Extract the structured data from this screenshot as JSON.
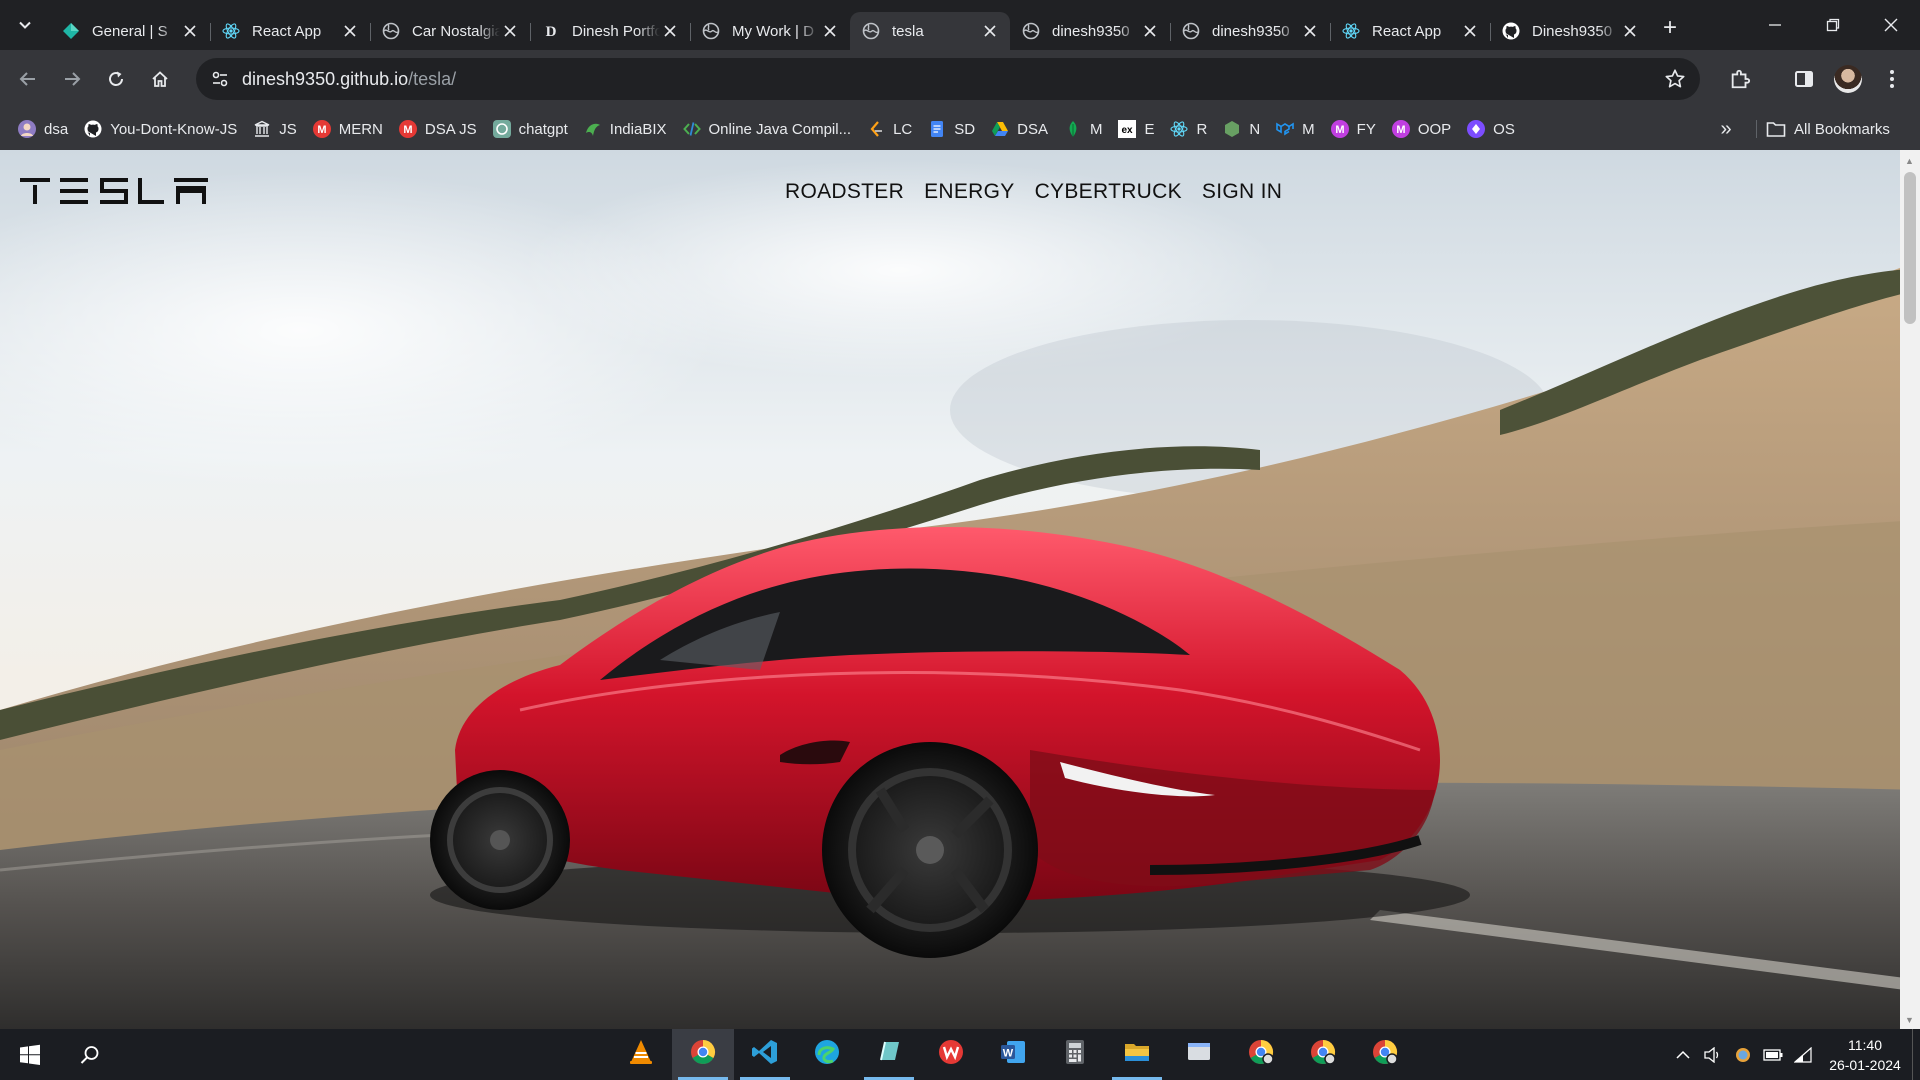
{
  "browser": {
    "tabs": [
      {
        "title": "General | S",
        "icon": "teams-diamond",
        "color": "#1fb6a6",
        "active": false
      },
      {
        "title": "React App",
        "icon": "react",
        "color": "#61dafb",
        "active": false
      },
      {
        "title": "Car Nostalgia",
        "icon": "globe",
        "color": "#bdc1c6",
        "active": false
      },
      {
        "title": "Dinesh Portfolio",
        "icon": "letter-d",
        "color": "#000000",
        "active": false
      },
      {
        "title": "My Work | D",
        "icon": "globe",
        "color": "#bdc1c6",
        "active": false
      },
      {
        "title": "tesla",
        "icon": "globe",
        "color": "#bdc1c6",
        "active": true
      },
      {
        "title": "dinesh9350",
        "icon": "globe",
        "color": "#bdc1c6",
        "active": false
      },
      {
        "title": "dinesh9350",
        "icon": "globe",
        "color": "#bdc1c6",
        "active": false
      },
      {
        "title": "React App",
        "icon": "react",
        "color": "#61dafb",
        "active": false
      },
      {
        "title": "Dinesh9350",
        "icon": "github",
        "color": "#ffffff",
        "active": false
      }
    ],
    "url_host": "dinesh9350.github.io",
    "url_path": "/tesla/",
    "bookmarks": [
      {
        "label": "dsa",
        "icon": "avatar",
        "color": "#8e7cc3"
      },
      {
        "label": "You-Dont-Know-JS",
        "icon": "github",
        "color": "#ffffff"
      },
      {
        "label": "JS",
        "icon": "building",
        "color": "#e8eaed"
      },
      {
        "label": "MERN",
        "icon": "letter-m",
        "color": "#e53935"
      },
      {
        "label": "DSA JS",
        "icon": "letter-m",
        "color": "#e53935"
      },
      {
        "label": "chatgpt",
        "icon": "chatgpt",
        "color": "#74aa9c"
      },
      {
        "label": "IndiaBIX",
        "icon": "indiabix",
        "color": "#4caf50"
      },
      {
        "label": "Online Java Compil...",
        "icon": "code",
        "color": "#4caf50"
      },
      {
        "label": "LC",
        "icon": "leetcode",
        "color": "#ffa116"
      },
      {
        "label": "SD",
        "icon": "doc",
        "color": "#4285f4"
      },
      {
        "label": "DSA",
        "icon": "drive",
        "color": "#fbbc04"
      },
      {
        "label": "M",
        "icon": "mongodb",
        "color": "#13aa52"
      },
      {
        "label": "E",
        "icon": "express",
        "color": "#ffffff"
      },
      {
        "label": "R",
        "icon": "react",
        "color": "#61dafb"
      },
      {
        "label": "N",
        "icon": "node",
        "color": "#68a063"
      },
      {
        "label": "M",
        "icon": "mui",
        "color": "#2196f3"
      },
      {
        "label": "FY",
        "icon": "letter-m",
        "color": "#c03fe0"
      },
      {
        "label": "OOP",
        "icon": "letter-m",
        "color": "#c03fe0"
      },
      {
        "label": "OS",
        "icon": "diamond",
        "color": "#7c4dff"
      }
    ],
    "all_bookmarks_label": "All Bookmarks"
  },
  "page": {
    "logo_text": "TESLA",
    "menu": [
      "ROADSTER",
      "ENERGY",
      "CYBERTRUCK",
      "SIGN IN"
    ],
    "hero_car_color": "#c8102e"
  },
  "taskbar": {
    "apps": [
      {
        "name": "vlc-icon",
        "color": "#f08a00",
        "active": false,
        "running": false
      },
      {
        "name": "chrome-icon",
        "color": "#34a853",
        "active": true,
        "running": true
      },
      {
        "name": "vscode-icon",
        "color": "#2d9fd9",
        "active": false,
        "running": true
      },
      {
        "name": "edge-icon",
        "color": "#1ea5e0",
        "active": false,
        "running": false
      },
      {
        "name": "notes-icon",
        "color": "#6fc7c9",
        "active": false,
        "running": true
      },
      {
        "name": "wps-icon",
        "color": "#e53935",
        "active": false,
        "running": false
      },
      {
        "name": "word-icon",
        "color": "#2b579a",
        "active": false,
        "running": false
      },
      {
        "name": "calculator-icon",
        "color": "#9aa0a6",
        "active": false,
        "running": false
      },
      {
        "name": "file-explorer-icon",
        "color": "#f4c542",
        "active": false,
        "running": true
      },
      {
        "name": "window-icon",
        "color": "#8ab4f8",
        "active": false,
        "running": false
      },
      {
        "name": "chrome-profile-icon",
        "color": "#34a853",
        "active": false,
        "running": false
      },
      {
        "name": "chrome-profile-icon",
        "color": "#34a853",
        "active": false,
        "running": false
      },
      {
        "name": "chrome-profile-icon",
        "color": "#34a853",
        "active": false,
        "running": false
      }
    ],
    "time": "11:40",
    "date": "26-01-2024"
  }
}
